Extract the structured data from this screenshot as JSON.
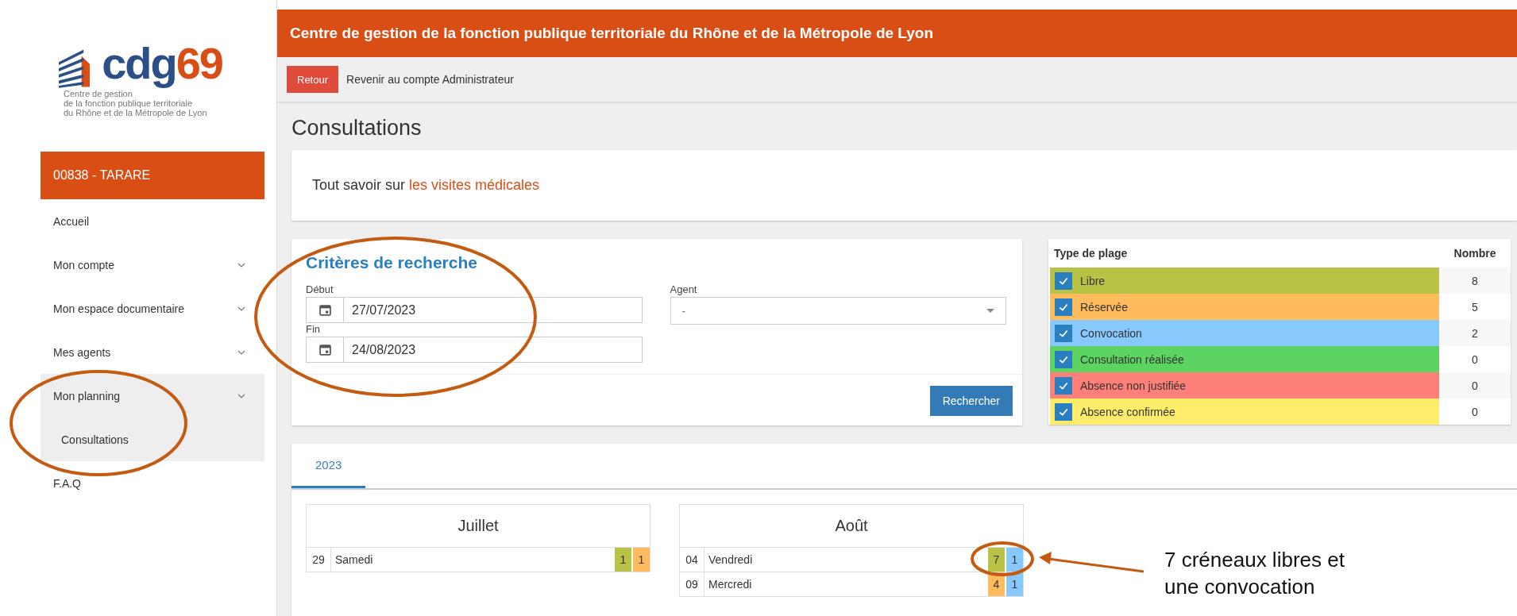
{
  "logo": {
    "letters": "cdg",
    "digits": "69",
    "subtitle": [
      "Centre de gestion",
      "de la fonction publique territoriale",
      "du Rhône et de la Métropole de Lyon"
    ]
  },
  "sidebar": {
    "account": "00838 - TARARE",
    "items": [
      {
        "label": "Accueil",
        "expandable": false,
        "expanded": false
      },
      {
        "label": "Mon compte",
        "expandable": true,
        "expanded": false
      },
      {
        "label": "Mon espace documentaire",
        "expandable": true,
        "expanded": false
      },
      {
        "label": "Mes agents",
        "expandable": true,
        "expanded": false
      },
      {
        "label": "Mon planning",
        "expandable": true,
        "expanded": true,
        "children": [
          {
            "label": "Consultations"
          }
        ]
      },
      {
        "label": "F.A.Q",
        "expandable": false,
        "expanded": false
      }
    ]
  },
  "header": {
    "title": "Centre de gestion de la fonction publique territoriale du Rhône et de la Métropole de Lyon"
  },
  "admin_bar": {
    "button": "Retour",
    "text": "Revenir au compte Administrateur"
  },
  "page_title": "Consultations",
  "info": {
    "text": "Tout savoir sur",
    "link": "les visites médicales"
  },
  "search": {
    "title": "Critères de recherche",
    "start_label": "Début",
    "start_value": "27/07/2023",
    "end_label": "Fin",
    "end_value": "24/08/2023",
    "agent_label": "Agent",
    "agent_value": "-",
    "button": "Rechercher"
  },
  "legend": {
    "columns": [
      "Type de plage",
      "Nombre"
    ],
    "rows": [
      {
        "label": "Libre",
        "count": "8",
        "color": "#b8c245",
        "checked": true
      },
      {
        "label": "Réservée",
        "count": "5",
        "color": "#ffbb5c",
        "checked": true
      },
      {
        "label": "Convocation",
        "count": "2",
        "color": "#87c8fd",
        "checked": true
      },
      {
        "label": "Consultation réalisée",
        "count": "0",
        "color": "#5dd462",
        "checked": true
      },
      {
        "label": "Absence non justifiée",
        "count": "0",
        "color": "#ff8079",
        "checked": true
      },
      {
        "label": "Absence confirmée",
        "count": "0",
        "color": "#ffec6b",
        "checked": true
      }
    ]
  },
  "tabs": [
    {
      "label": "2023",
      "selected": true
    }
  ],
  "months": [
    {
      "name": "Juillet",
      "days": [
        {
          "day": "29",
          "weekday": "Samedi",
          "counts": [
            {
              "value": "1",
              "color": "#b8c245"
            },
            {
              "value": "1",
              "color": "#ffbb5c"
            }
          ]
        }
      ]
    },
    {
      "name": "Août",
      "days": [
        {
          "day": "04",
          "weekday": "Vendredi",
          "counts": [
            {
              "value": "7",
              "color": "#b8c245"
            },
            {
              "value": "1",
              "color": "#87c8fd"
            }
          ]
        },
        {
          "day": "09",
          "weekday": "Mercredi",
          "counts": [
            {
              "value": "4",
              "color": "#ffbb5c"
            },
            {
              "value": "1",
              "color": "#87c8fd"
            }
          ]
        }
      ]
    }
  ],
  "annotation": {
    "text": "7 créneaux libres et une convocation"
  }
}
